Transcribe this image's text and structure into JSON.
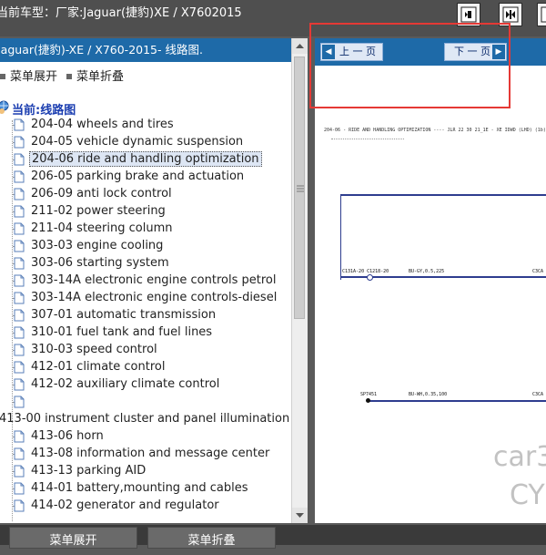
{
  "header": {
    "title": "当前车型：厂家:Jaguar(捷豹)XE / X7602015"
  },
  "toolbar": {
    "buttons": [
      "window-left-icon",
      "window-split-icon",
      "window-right-icon"
    ]
  },
  "left_panel": {
    "header": "Jaguar(捷豹)-XE / X760-2015- 线路图.",
    "expand_label": "菜单展开",
    "collapse_label": "菜单折叠",
    "root_label": "当前:线路图",
    "items": [
      {
        "label": "204-04 wheels and tires"
      },
      {
        "label": "204-05 vehicle dynamic suspension"
      },
      {
        "label": "204-06 ride and handling optimization",
        "selected": true
      },
      {
        "label": "206-05 parking brake and actuation"
      },
      {
        "label": "206-09 anti lock control"
      },
      {
        "label": "211-02 power steering"
      },
      {
        "label": "211-04 steering column"
      },
      {
        "label": "303-03 engine cooling"
      },
      {
        "label": "303-06 starting system"
      },
      {
        "label": "303-14A electronic engine controls petrol"
      },
      {
        "label": "303-14A electronic engine controls-diesel"
      },
      {
        "label": "307-01 automatic transmission"
      },
      {
        "label": "310-01 fuel tank and fuel lines"
      },
      {
        "label": "310-03 speed control"
      },
      {
        "label": "412-01 climate control"
      },
      {
        "label": "412-02 auxiliary climate control"
      },
      {
        "label": ""
      },
      {
        "label": "413-00 instrument cluster and panel illumination",
        "top_level": true
      },
      {
        "label": "413-06 horn"
      },
      {
        "label": "413-08 information and message center"
      },
      {
        "label": "413-13 parking AID"
      },
      {
        "label": "414-01 battery,mounting and cables"
      },
      {
        "label": "414-02 generator and regulator"
      }
    ]
  },
  "right_panel": {
    "prev_label": "上 一 页",
    "next_label": "下 一 页",
    "diagram_title": "204-06 - RIDE AND HANDLING OPTIMIZATION ---- JLR 22 30 21_1E - XE IDWD (LHD) (1b)",
    "wire1_left": "C131A-20  C1218-20",
    "wire1_mid": "BU-GY,0.5,225",
    "wire1_right": "C3CA",
    "wire2_left": "SP7451",
    "wire2_mid": "BU-WH,0.35,100",
    "wire2_right": "C3CA",
    "watermark_line1": "car3",
    "watermark_line2": "CY"
  },
  "bottom_bar": {
    "expand_label": "菜单展开",
    "collapse_label": "菜单折叠"
  }
}
